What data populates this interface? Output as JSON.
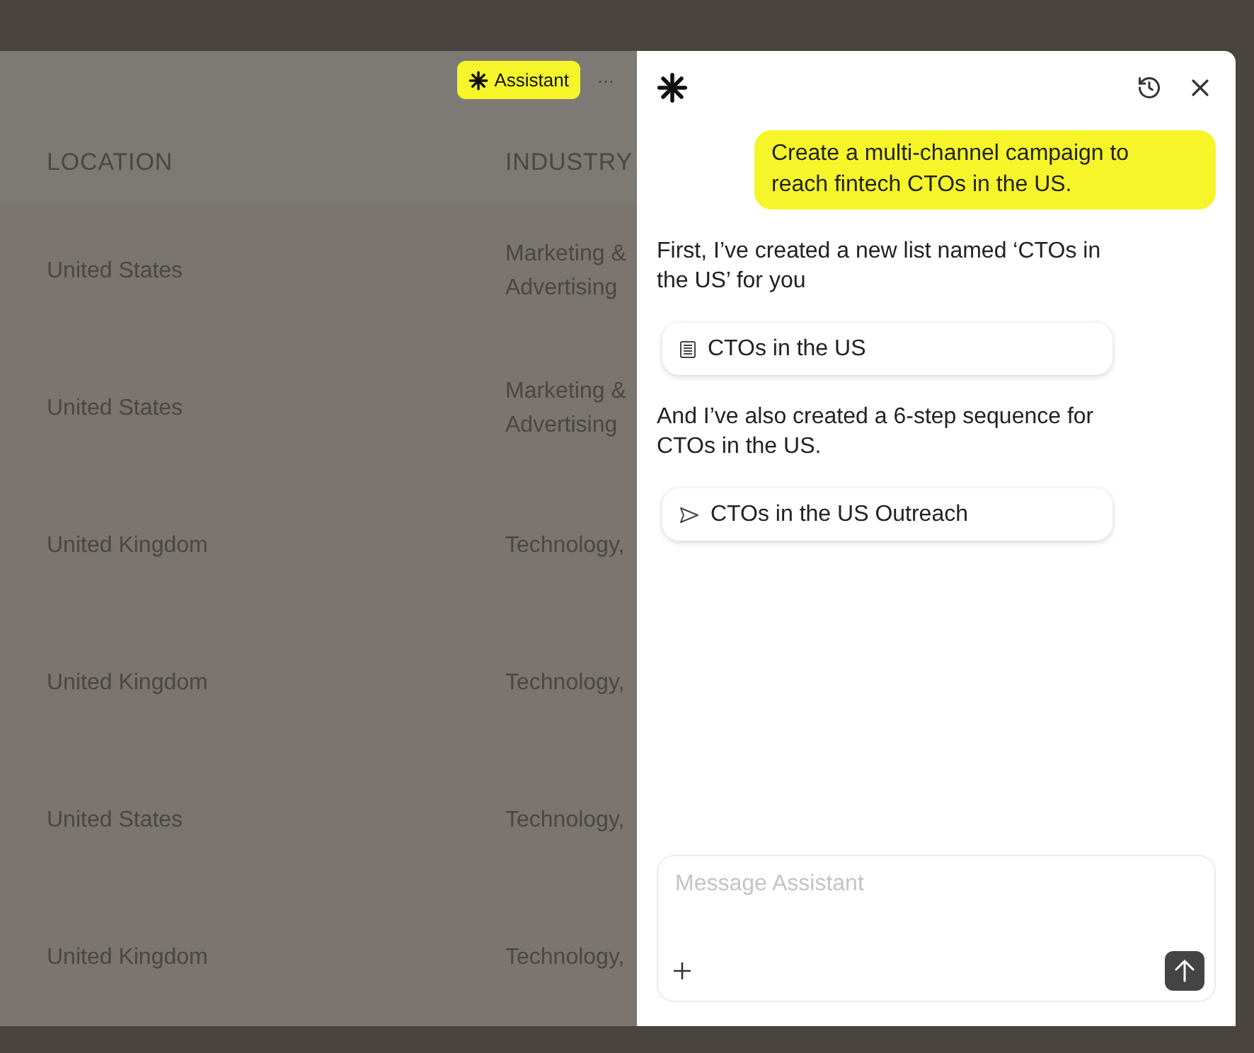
{
  "toolbar": {
    "assistant_button": "Assistant",
    "more_button": "···"
  },
  "table": {
    "columns": [
      "LOCATION",
      "INDUSTRY"
    ],
    "rows": [
      {
        "location": "United States",
        "industry": "Marketing & Advertising"
      },
      {
        "location": "United States",
        "industry": "Marketing & Advertising"
      },
      {
        "location": "United Kingdom",
        "industry": "Technology,"
      },
      {
        "location": "United Kingdom",
        "industry": "Technology,"
      },
      {
        "location": "United States",
        "industry": "Technology,"
      },
      {
        "location": "United Kingdom",
        "industry": "Technology,"
      }
    ]
  },
  "assistant": {
    "messages": [
      {
        "kind": "user",
        "text": "Create a multi-channel campaign to reach fintech CTOs in the US."
      },
      {
        "kind": "assistant",
        "text": "First, I’ve created a new list named ‘CTOs in the US’ for you"
      },
      {
        "kind": "list_link",
        "text": "CTOs in the US"
      },
      {
        "kind": "assistant",
        "text": "And I’ve also created a 6-step sequence for CTOs in the US."
      },
      {
        "kind": "sequence_link",
        "text": "CTOs in the US Outreach"
      }
    ],
    "composer": {
      "placeholder": "Message Assistant"
    }
  }
}
